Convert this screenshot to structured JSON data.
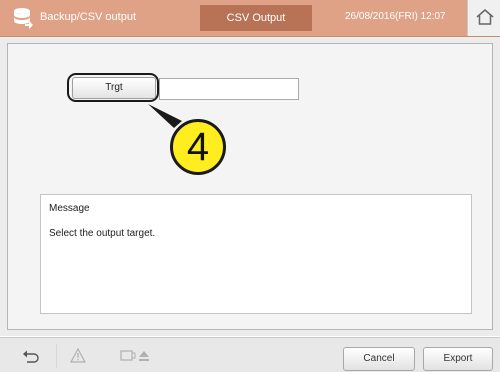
{
  "header": {
    "app_title": "Backup/CSV output",
    "active_tab": "CSV Output",
    "datetime": "26/08/2016(FRI) 12:07",
    "app_icon": "database-export-icon",
    "home_icon": "home-icon"
  },
  "target": {
    "button_label": "Trgt",
    "field_value": ""
  },
  "callout": {
    "number": "4"
  },
  "message": {
    "title": "Message",
    "text": "Select the output target."
  },
  "footer": {
    "back_icon": "back-arrow-icon",
    "warning_icon": "warning-icon",
    "media_icon": "media-eject-icon",
    "cancel_label": "Cancel",
    "export_label": "Export"
  },
  "colors": {
    "header_bg": "#dfa287",
    "tab_active_bg": "#b87357",
    "callout_fill": "#ffed1f"
  }
}
